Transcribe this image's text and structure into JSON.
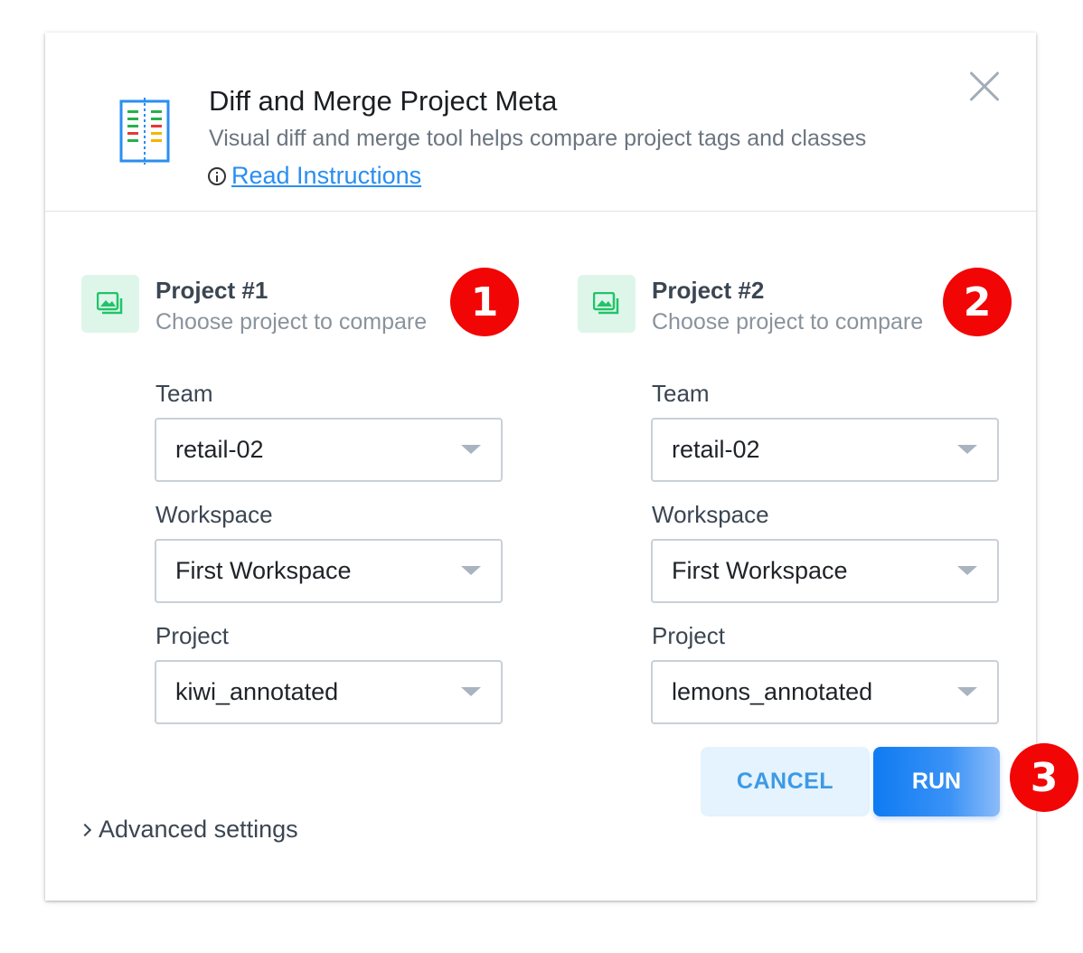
{
  "dialog": {
    "title": "Diff and Merge Project Meta",
    "subtitle": "Visual diff and merge tool helps compare project tags and classes",
    "read_instructions": "Read Instructions",
    "close_icon": "close-icon"
  },
  "projects": [
    {
      "title": "Project #1",
      "description": "Choose project to compare",
      "badge": "1",
      "team_label": "Team",
      "team_value": "retail-02",
      "workspace_label": "Workspace",
      "workspace_value": "First Workspace",
      "project_label": "Project",
      "project_value": "kiwi_annotated"
    },
    {
      "title": "Project #2",
      "description": "Choose project to compare",
      "badge": "2",
      "team_label": "Team",
      "team_value": "retail-02",
      "workspace_label": "Workspace",
      "workspace_value": "First Workspace",
      "project_label": "Project",
      "project_value": "lemons_annotated"
    }
  ],
  "actions": {
    "cancel_label": "CANCEL",
    "run_label": "RUN",
    "run_badge": "3"
  },
  "advanced_settings": "Advanced settings",
  "colors": {
    "accent": "#0f7bf2",
    "badge": "#f20505",
    "project_icon_bg": "#def6e9",
    "project_icon_fg": "#22c36a"
  }
}
